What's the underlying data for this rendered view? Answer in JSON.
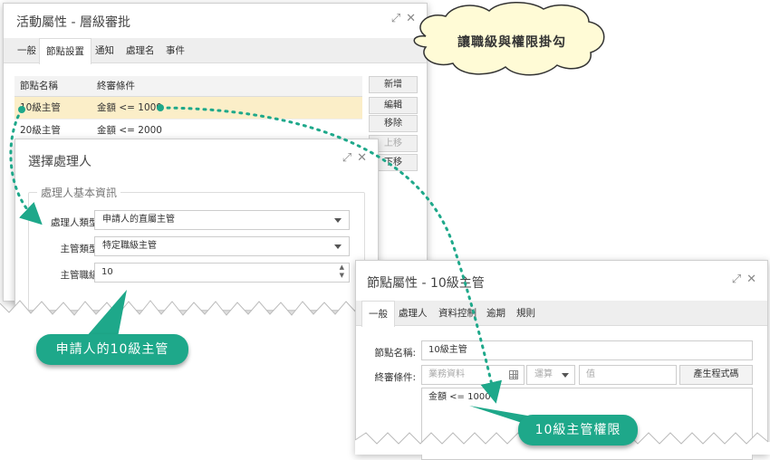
{
  "dlg1": {
    "title": "活動屬性 - 層級審批",
    "tabs": [
      "一般",
      "節點設置",
      "通知",
      "處理名",
      "事件"
    ],
    "columns": [
      "節點名稱",
      "終審條件"
    ],
    "rows": [
      {
        "name": "10級主管",
        "condition": "金額 <= 1000"
      },
      {
        "name": "20級主管",
        "condition": "金額 <= 2000"
      }
    ],
    "buttons": [
      "新增",
      "編輯",
      "移除",
      "上移",
      "下移"
    ]
  },
  "dlg2": {
    "title": "選擇處理人",
    "legend": "處理人基本資訊",
    "handler_type_label": "處理人類型:",
    "handler_type_value": "申請人的直屬主管",
    "manager_type_label": "主管類型:",
    "manager_type_value": "特定職級主管",
    "manager_level_label": "主管職級:",
    "manager_level_value": "10"
  },
  "dlg3": {
    "title": "節點屬性 - 10級主管",
    "tabs": [
      "一般",
      "處理人",
      "資料控制",
      "逾期",
      "規則"
    ],
    "node_name_label": "節點名稱:",
    "node_name_value": "10級主管",
    "condition_label": "終審條件:",
    "business_data_placeholder": "業務資料",
    "operator_placeholder": "運算",
    "value_placeholder": "值",
    "generate_button": "產生程式碼",
    "condition_text": "金額 <= 1000"
  },
  "callouts": {
    "cloud": "讓職級與權限掛勾",
    "bubble_left": "申請人的10級主管",
    "bubble_right": "10級主管權限"
  },
  "colors": {
    "accent": "#1ea88a",
    "highlight_row": "#fbeec8"
  }
}
